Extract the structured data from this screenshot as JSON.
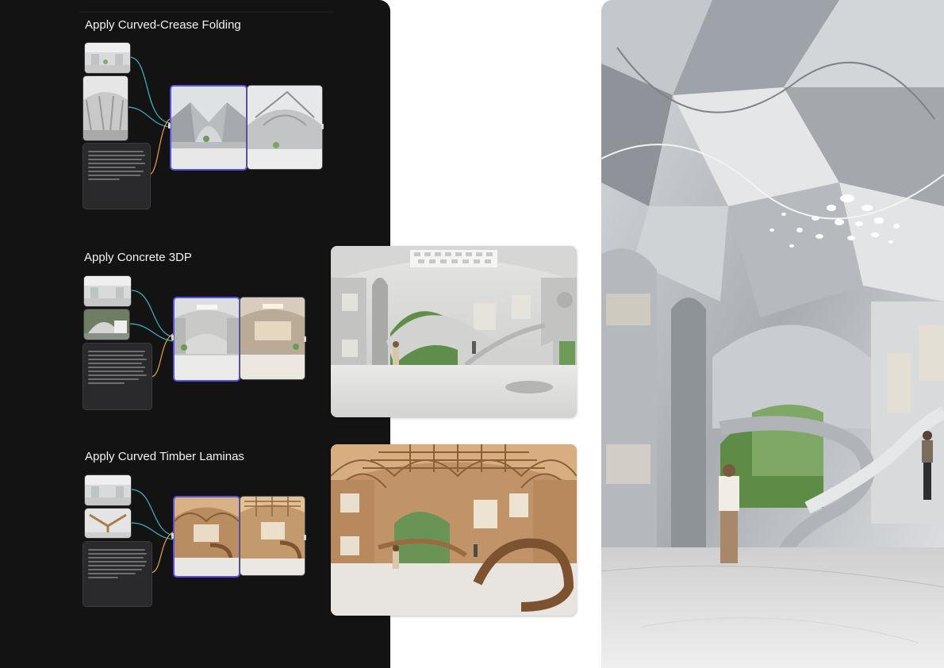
{
  "sections": [
    {
      "title": "Apply Curved-Crease Folding"
    },
    {
      "title": "Apply Concrete 3DP"
    },
    {
      "title": "Apply Curved Timber Laminas"
    }
  ],
  "colors": {
    "panel_bg": "#131314",
    "selection": "#5b4fe0",
    "wire_teal": "#3bb6c4",
    "wire_orange": "#e8a23a"
  },
  "icons": [
    "wire-connector",
    "node-handle"
  ]
}
